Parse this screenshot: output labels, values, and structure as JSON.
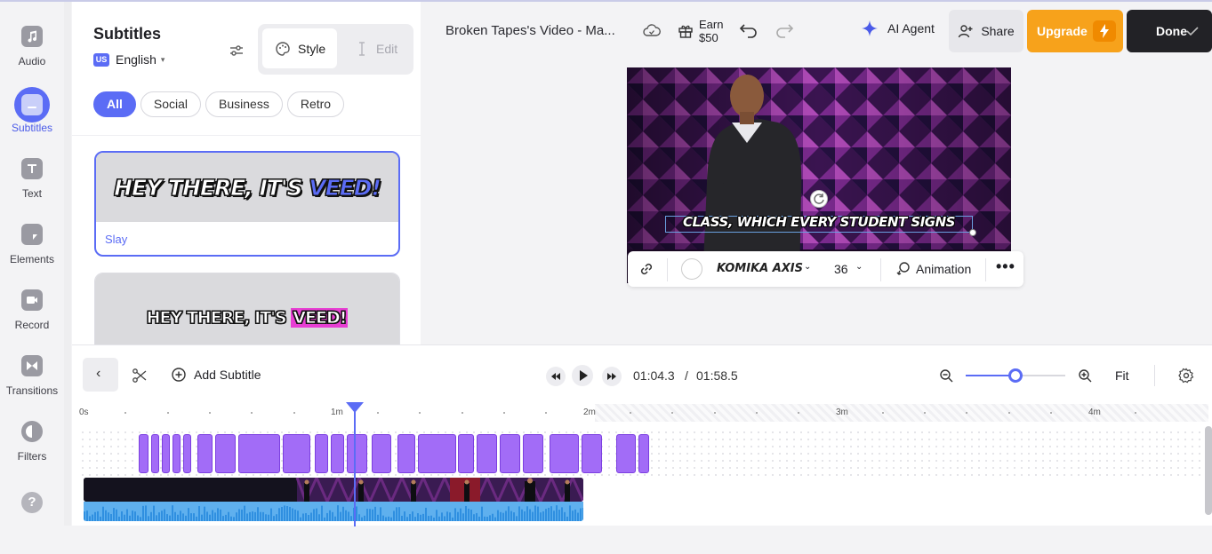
{
  "rail": {
    "items": [
      {
        "label": "Audio",
        "icon": "music-note-icon"
      },
      {
        "label": "Subtitles",
        "icon": "subtitles-icon"
      },
      {
        "label": "Text",
        "icon": "text-icon"
      },
      {
        "label": "Elements",
        "icon": "elements-icon"
      },
      {
        "label": "Record",
        "icon": "record-camera-icon"
      },
      {
        "label": "Transitions",
        "icon": "transitions-icon"
      },
      {
        "label": "Filters",
        "icon": "filters-icon"
      }
    ],
    "help": "?"
  },
  "panel": {
    "title": "Subtitles",
    "language_flag": "US",
    "language": "English",
    "tabs": {
      "style": "Style",
      "edit": "Edit"
    },
    "filters": [
      "All",
      "Social",
      "Business",
      "Retro"
    ],
    "presets": [
      {
        "preview_prefix": "HEY THERE, IT'S ",
        "preview_highlight": "VEED!",
        "name": "Slay",
        "highlight_color": "#5b6cf5"
      },
      {
        "preview_prefix": "HEY THERE, IT'S ",
        "preview_highlight": "VEED!",
        "name": "",
        "highlight_color": "#e73fd3"
      }
    ]
  },
  "header": {
    "project_title": "Broken Tapes's Video - Ma...",
    "earn_line1": "Earn",
    "earn_line2": "$50",
    "ai_agent": "AI Agent",
    "share": "Share",
    "upgrade": "Upgrade",
    "done": "Done"
  },
  "canvas": {
    "subtitle_text": "CLASS, WHICH EVERY STUDENT SIGNS"
  },
  "text_toolbar": {
    "font": "KOMIKA AXIS",
    "size": "36",
    "animation": "Animation",
    "more": "•••"
  },
  "timeline": {
    "add_subtitle": "Add Subtitle",
    "current_time": "01:04.3",
    "separator": "/",
    "total_time": "01:58.5",
    "fit": "Fit",
    "zoom_fraction": 0.5,
    "ruler_labels": [
      "0s",
      "1m",
      "2m",
      "3m",
      "4m"
    ]
  },
  "colors": {
    "accent": "#5b6cf5",
    "upgrade": "#f7a21b",
    "subtitle_clip": "#a26cf7",
    "audio_wave": "#5fb0ee"
  }
}
